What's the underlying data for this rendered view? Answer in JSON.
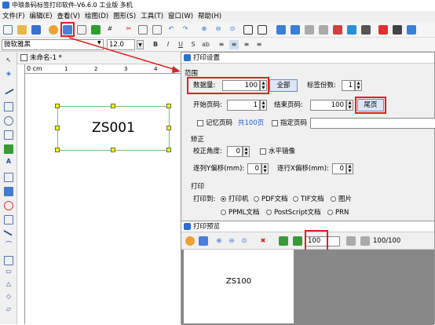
{
  "app": {
    "title": "中琅条码标签打印软件-V6.6.0 工业版 多机"
  },
  "menu": [
    "文件(F)",
    "编辑(E)",
    "查看(V)",
    "绘图(D)",
    "图形(S)",
    "工具(T)",
    "窗口(W)",
    "帮助(H)"
  ],
  "format": {
    "font": "微软雅黑",
    "size": "12.0"
  },
  "document": {
    "tab": "未命名-1 *",
    "ruler_unit": "0 cm",
    "ruler_ticks": [
      "1",
      "2",
      "3",
      "4"
    ],
    "label_text": "ZS001"
  },
  "print_dialog": {
    "title": "打印设置",
    "range_section": "范围",
    "data_count_label": "数据量:",
    "data_count_value": "100",
    "all_button": "全部",
    "copies_label": "标签份数:",
    "copies_value": "1",
    "start_page_label": "开始页码:",
    "start_page_value": "1",
    "end_page_label": "结束页码:",
    "end_page_value": "100",
    "last_page_button": "尾页",
    "remember_page_label": "记忆页码",
    "total_pages": "共100页",
    "specify_page_label": "指定页码",
    "correction_section": "矫正",
    "angle_label": "校正角度:",
    "angle_value": "0",
    "mirror_label": "水平镜像",
    "offset_y_label": "逐列Y偏移(mm):",
    "offset_y_value": "0",
    "offset_x_label": "逐行X偏移(mm):",
    "offset_x_value": "0",
    "print_section": "打印",
    "print_to_label": "打印到:",
    "options": [
      "打印机",
      "PDF文档",
      "TIF文档",
      "图片",
      "PPML文档",
      "PostScript文档",
      "PRN"
    ]
  },
  "preview": {
    "title": "打印预览",
    "page_input": "100",
    "page_count": "100/100",
    "preview_text": "ZS100"
  },
  "colors": {
    "red": "#e02020",
    "link": "#2a5ad8",
    "handle": "#ffff00",
    "select_border": "#66cc66"
  }
}
